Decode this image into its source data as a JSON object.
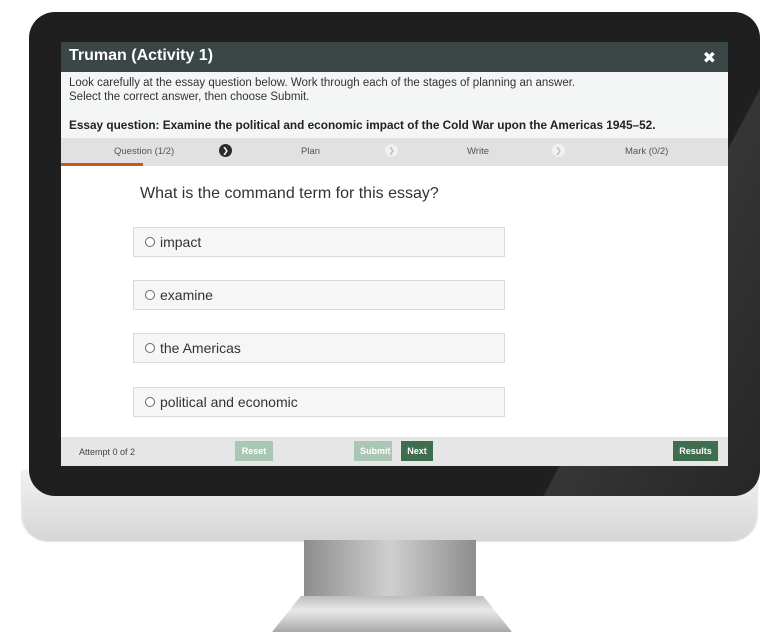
{
  "activity": {
    "title": "Truman (Activity 1)",
    "close_icon": "close-icon",
    "instructions": [
      "Look carefully at the essay question below. Work through each of the stages of planning an answer.",
      "Select the correct answer, then choose Submit."
    ],
    "essay_question": "Essay question: Examine the political and economic impact of the Cold War upon the Americas 1945–52."
  },
  "stages": [
    {
      "label": "Question (1/2)",
      "active": true
    },
    {
      "label": "Plan",
      "active": false
    },
    {
      "label": "Write",
      "active": false
    },
    {
      "label": "Mark (0/2)",
      "active": false
    }
  ],
  "question": {
    "text": "What is the command term for this essay?",
    "options": [
      "impact",
      "examine",
      "the Americas",
      "political and economic"
    ]
  },
  "footer": {
    "attempt": "Attempt 0 of 2",
    "reset": "Reset",
    "submit": "Submit",
    "next": "Next",
    "results": "Results"
  },
  "colors": {
    "titlebar": "#3b4646",
    "active_tab_underline": "#c65a1e",
    "button_primary": "#3f6e4e",
    "button_disabled": "#a9c7b4"
  }
}
